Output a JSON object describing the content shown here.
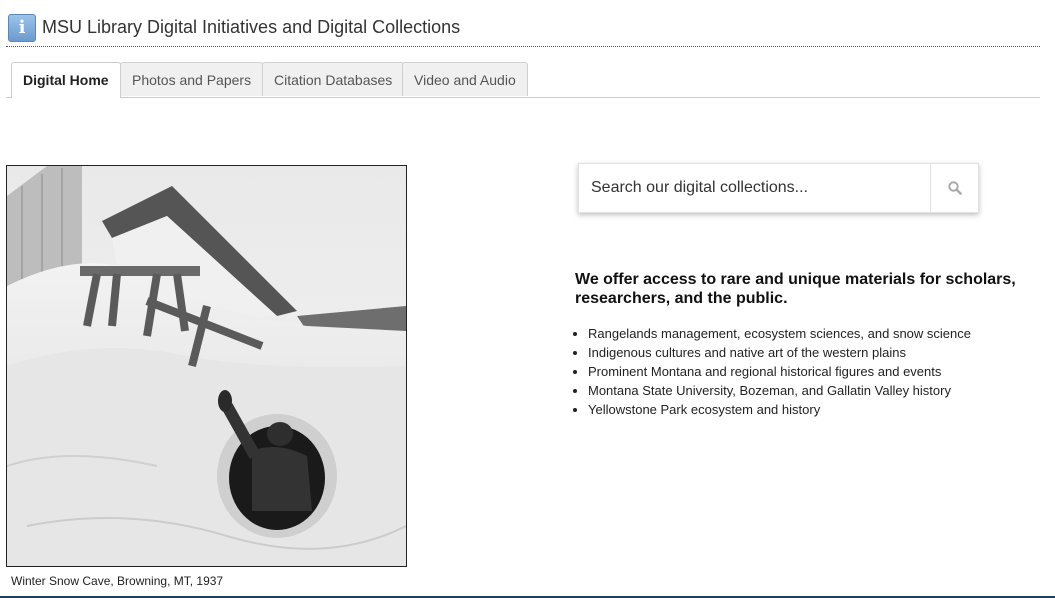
{
  "header": {
    "icon": "info-icon",
    "icon_glyph": "i",
    "title": "MSU Library Digital Initiatives and Digital Collections"
  },
  "tabs": [
    {
      "label": "Digital Home",
      "active": true
    },
    {
      "label": "Photos and Papers",
      "active": false
    },
    {
      "label": "Citation Databases",
      "active": false
    },
    {
      "label": "Video and Audio",
      "active": false
    }
  ],
  "photo": {
    "caption": "Winter Snow Cave, Browning, MT, 1937"
  },
  "search": {
    "placeholder": "Search our digital collections...",
    "button_icon": "search-icon"
  },
  "main": {
    "headline": "We offer access to rare and unique materials for scholars, researchers, and the public.",
    "items": [
      "Rangelands management, ecosystem sciences, and snow science",
      "Indigenous cultures and native art of the western plains",
      "Prominent Montana and regional historical figures and events",
      "Montana State University, Bozeman, and Gallatin Valley history",
      "Yellowstone Park ecosystem and history"
    ]
  },
  "colors": {
    "accent_line": "#1f3e64",
    "info_icon": "#6b9bd0"
  }
}
